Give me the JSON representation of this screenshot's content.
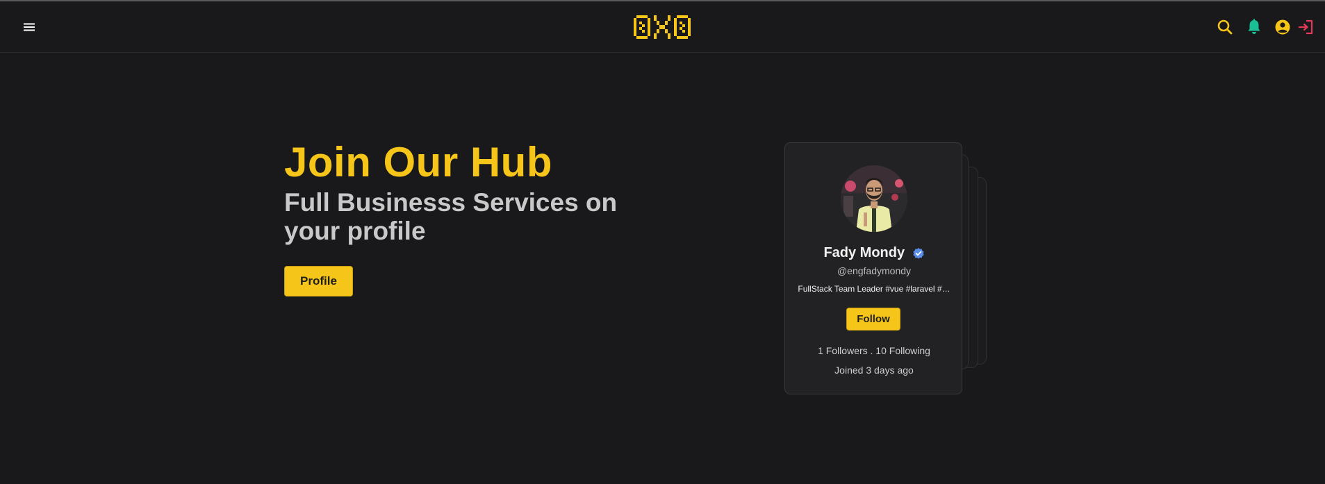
{
  "colors": {
    "background": "#19181a",
    "accent": "#f5c51a",
    "card": "#222124",
    "notification": "#1bbf96",
    "logout": "#e33a5a",
    "verified": "#5a8de8"
  },
  "header": {
    "menu_icon": "hamburger-menu-icon",
    "logo_text": "OXO",
    "icons": [
      "search-icon",
      "bell-icon",
      "user-circle-icon",
      "logout-icon"
    ]
  },
  "hero": {
    "title": "Join Our Hub",
    "subtitle": "Full Businesss Services on your profile",
    "button_label": "Profile"
  },
  "profile_card": {
    "name": "Fady Mondy",
    "verified_icon": "verified-badge-icon",
    "handle": "@engfadymondy",
    "bio": "FullStack Team Leader #vue #laravel #…",
    "follow_label": "Follow",
    "stats": "1 Followers . 10 Following",
    "joined": "Joined 3 days ago"
  }
}
